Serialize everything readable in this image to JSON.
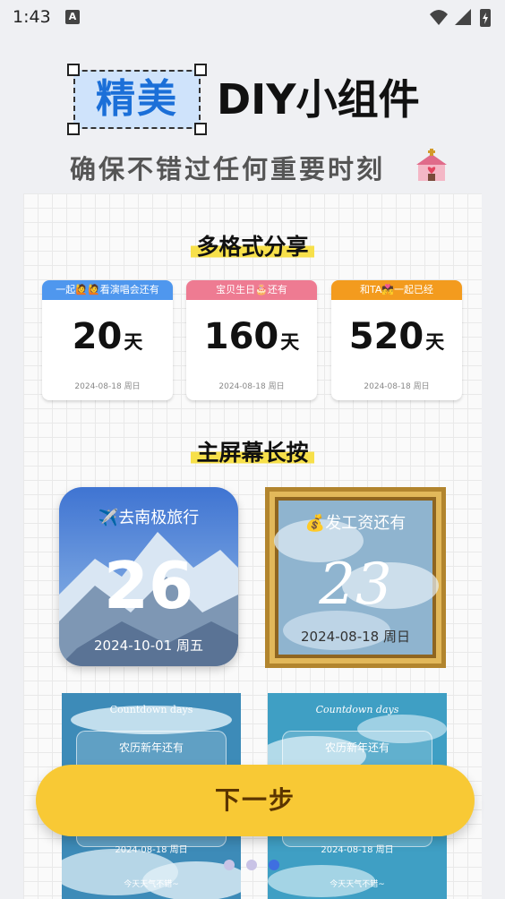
{
  "status_bar": {
    "time": "1:43",
    "notification_glyph": "A"
  },
  "hero": {
    "title_highlight": "精美",
    "title_rest": "DIY小组件",
    "subtitle": "确保不错过任何重要时刻",
    "subtitle_icon": "church-icon"
  },
  "share_section": {
    "title": "多格式分享",
    "cards": [
      {
        "header": "一起🙋🙋看演唱会还有",
        "number": "20",
        "unit": "天",
        "date": "2024-08-18 周日",
        "color": "#4f97ee"
      },
      {
        "header": "宝贝生日🎂还有",
        "number": "160",
        "unit": "天",
        "date": "2024-08-18 周日",
        "color": "#ee7b92"
      },
      {
        "header": "和TA💏一起已经",
        "number": "520",
        "unit": "天",
        "date": "2024-08-18 周日",
        "color": "#f39b1e"
      }
    ]
  },
  "home_section": {
    "title": "主屏幕长按",
    "widgets": [
      {
        "title": "✈️去南极旅行",
        "number": "26",
        "date": "2024-10-01 周五"
      },
      {
        "title": "💰发工资还有",
        "number": "23",
        "date": "2024-08-18 周日"
      },
      {
        "caption": "Countdown days",
        "label": "农历新年还有",
        "date": "2024-08-18 周日",
        "footer": "今天天气不错~"
      },
      {
        "caption": "Countdown days",
        "label": "农历新年还有",
        "date": "2024-08-18 周日",
        "footer": "今天天气不错~"
      }
    ]
  },
  "pager": {
    "count": 3,
    "active_index": 2
  },
  "next_button": {
    "label": "下一步"
  }
}
